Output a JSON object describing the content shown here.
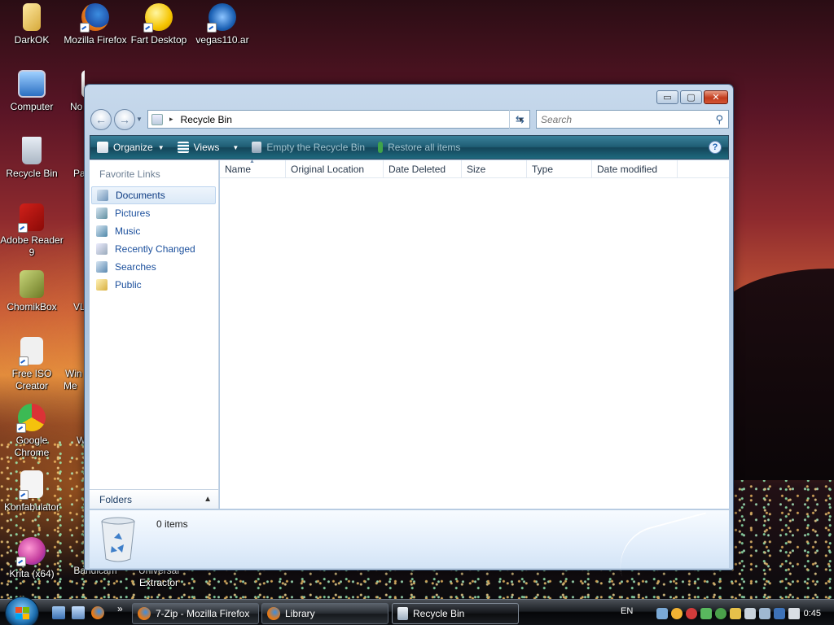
{
  "desktop": {
    "icons": [
      {
        "label": "DarkOK"
      },
      {
        "label": "Mozilla Firefox"
      },
      {
        "label": "Fart Desktop"
      },
      {
        "label": "vegas110.ar"
      },
      {
        "label": "Computer"
      },
      {
        "label": "No"
      },
      {
        "label": "Recycle Bin"
      },
      {
        "label": "Pa"
      },
      {
        "label": "Adobe Reader 9"
      },
      {
        "label": "ChomikBox"
      },
      {
        "label": "VL"
      },
      {
        "label": "Free ISO Creator"
      },
      {
        "label": "Win Me"
      },
      {
        "label": "Google Chrome"
      },
      {
        "label": "W"
      },
      {
        "label": "Konfabulator"
      },
      {
        "label": "Krita (x64)"
      },
      {
        "label": "Bandicam"
      },
      {
        "label": "Universal Extractor"
      }
    ]
  },
  "window": {
    "title_buttons": {
      "minimize": "▭",
      "maximize": "▢",
      "close": "✕"
    },
    "address": {
      "path": "Recycle Bin",
      "separator": "▸"
    },
    "search": {
      "placeholder": "Search"
    },
    "commands": {
      "organize": "Organize",
      "views": "Views",
      "empty": "Empty the Recycle Bin",
      "restore": "Restore all items"
    },
    "nav_pane": {
      "title": "Favorite Links",
      "links": [
        {
          "label": "Documents",
          "selected": true
        },
        {
          "label": "Pictures"
        },
        {
          "label": "Music"
        },
        {
          "label": "Recently Changed"
        },
        {
          "label": "Searches"
        },
        {
          "label": "Public"
        }
      ],
      "folders_label": "Folders"
    },
    "columns": [
      "Name",
      "Original Location",
      "Date Deleted",
      "Size",
      "Type",
      "Date modified"
    ],
    "details": {
      "count_text": "0 items"
    }
  },
  "taskbar": {
    "buttons": [
      {
        "label": "7-Zip - Mozilla Firefox"
      },
      {
        "label": "Library"
      },
      {
        "label": "Recycle Bin",
        "active": true
      }
    ],
    "overflow": "»",
    "language": "EN",
    "clock": "0:45"
  },
  "colors": {
    "command_bar": "#1f5d74",
    "link_blue": "#1b4f9c",
    "close_red": "#c23b1d"
  }
}
